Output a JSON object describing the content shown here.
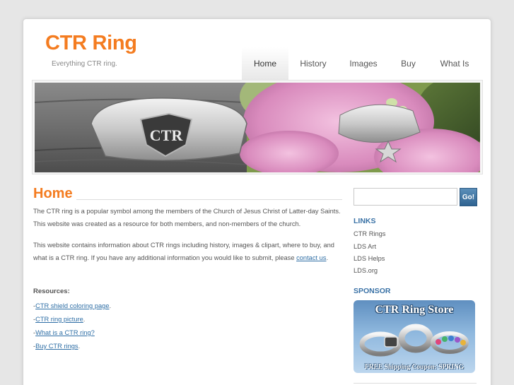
{
  "site": {
    "logo": "CTR Ring",
    "tagline": "Everything CTR ring."
  },
  "nav": {
    "items": [
      "Home",
      "History",
      "Images",
      "Buy",
      "What Is"
    ],
    "active": "Home"
  },
  "content": {
    "title": "Home",
    "para1": "The CTR ring is a popular symbol among the members of the Church of Jesus Christ of Latter-day Saints. This website was created as a resource for both members, and non-members of the church.",
    "para2_text": "This website contains information about CTR rings including history, images & clipart, where to buy, and what is a CTR ring. If you have any additional information you would like to submit, please ",
    "para2_link": "contact us",
    "para2_end": ".",
    "resources_heading": "Resources:",
    "resources": [
      "CTR shield coloring page",
      "CTR ring picture",
      "What is a CTR ring?",
      "Buy CTR rings"
    ],
    "resource_prefix": "-",
    "resource_suffix": "."
  },
  "sidebar": {
    "search_placeholder": "",
    "search_button": "Go!",
    "links_heading": "LINKS",
    "links": [
      "CTR Rings",
      "LDS Art",
      "LDS Helps",
      "LDS.org"
    ],
    "sponsor_heading": "SPONSOR",
    "sponsor_title": "CTR Ring Store",
    "sponsor_coupon": "FREE Shipping Coupon: SPRING"
  },
  "colors": {
    "accent": "#f47c20",
    "link": "#2e6ea5",
    "sidebar_heading": "#3a72a6"
  },
  "icons": {
    "hero": "ctr-ring-photo",
    "sponsor": "ctr-ring-store-banner"
  }
}
